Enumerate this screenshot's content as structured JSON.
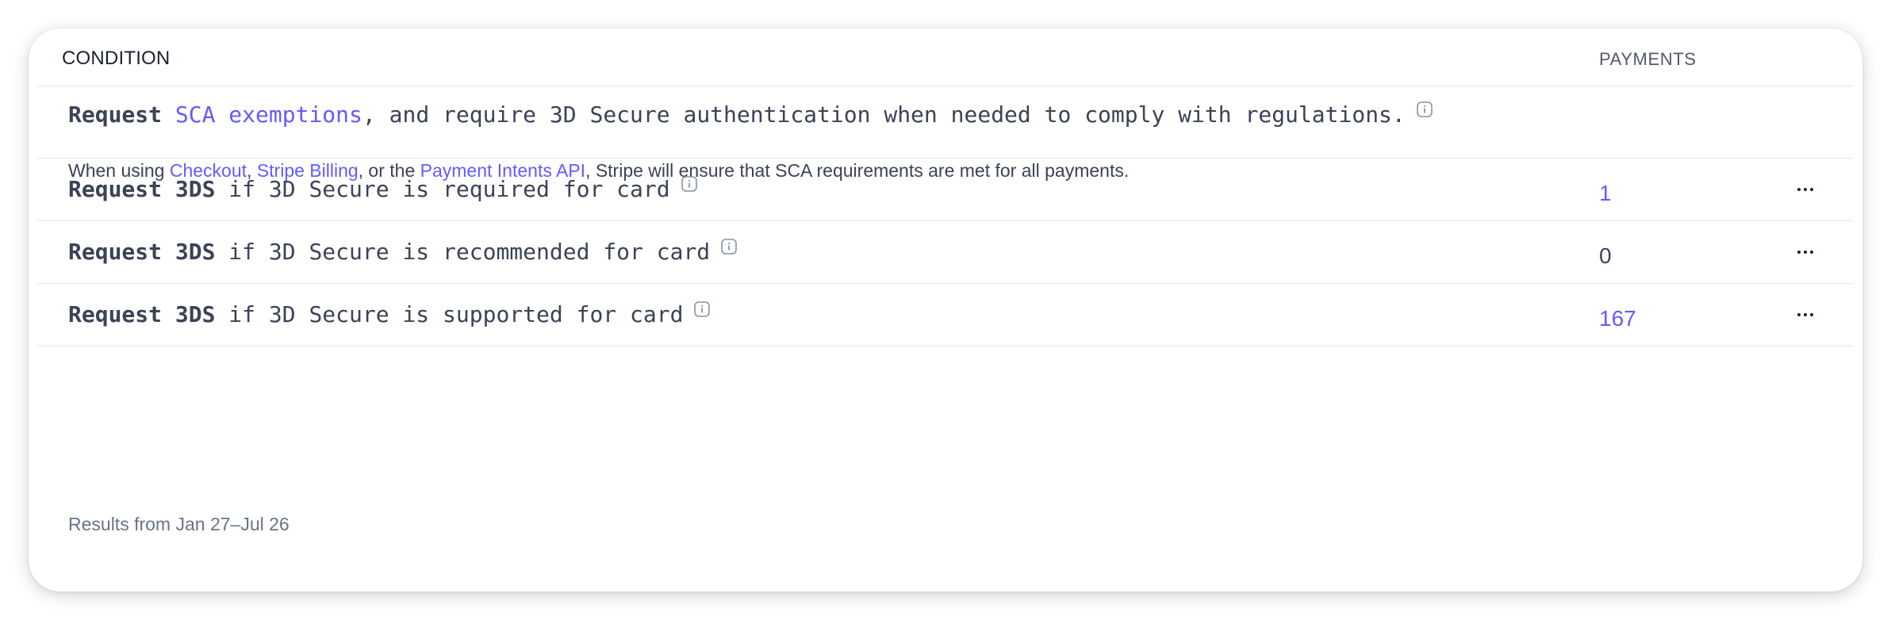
{
  "table": {
    "header": {
      "condition": "CONDITION",
      "payments": "PAYMENTS"
    },
    "sca_row": {
      "request_word": "Request",
      "sca_link": "SCA exemptions",
      "rest": ", and require 3D Secure authentication when needed to comply with regulations.",
      "sub_prefix": "When using ",
      "checkout_link": "Checkout",
      "comma": ", ",
      "billing_link": "Stripe Billing",
      "or_the": ", or the ",
      "pi_link": "Payment Intents API",
      "sub_suffix": ", Stripe will ensure that SCA requirements are met for all payments."
    },
    "rows": [
      {
        "action": "Request 3DS",
        "condition": " if 3D Secure is required for card",
        "payments": "1"
      },
      {
        "action": "Request 3DS",
        "condition": " if 3D Secure is recommended for card",
        "payments": "0"
      },
      {
        "action": "Request 3DS",
        "condition": " if 3D Secure is supported for card",
        "payments": "167"
      }
    ],
    "footer": "Results from Jan 27–Jul 26"
  },
  "colors": {
    "accent": "#635bff",
    "text": "#3c4257",
    "muted": "#697386",
    "divider": "#e6e8ee"
  },
  "icons": {
    "info": "info-icon",
    "more": "more-horizontal-icon"
  }
}
